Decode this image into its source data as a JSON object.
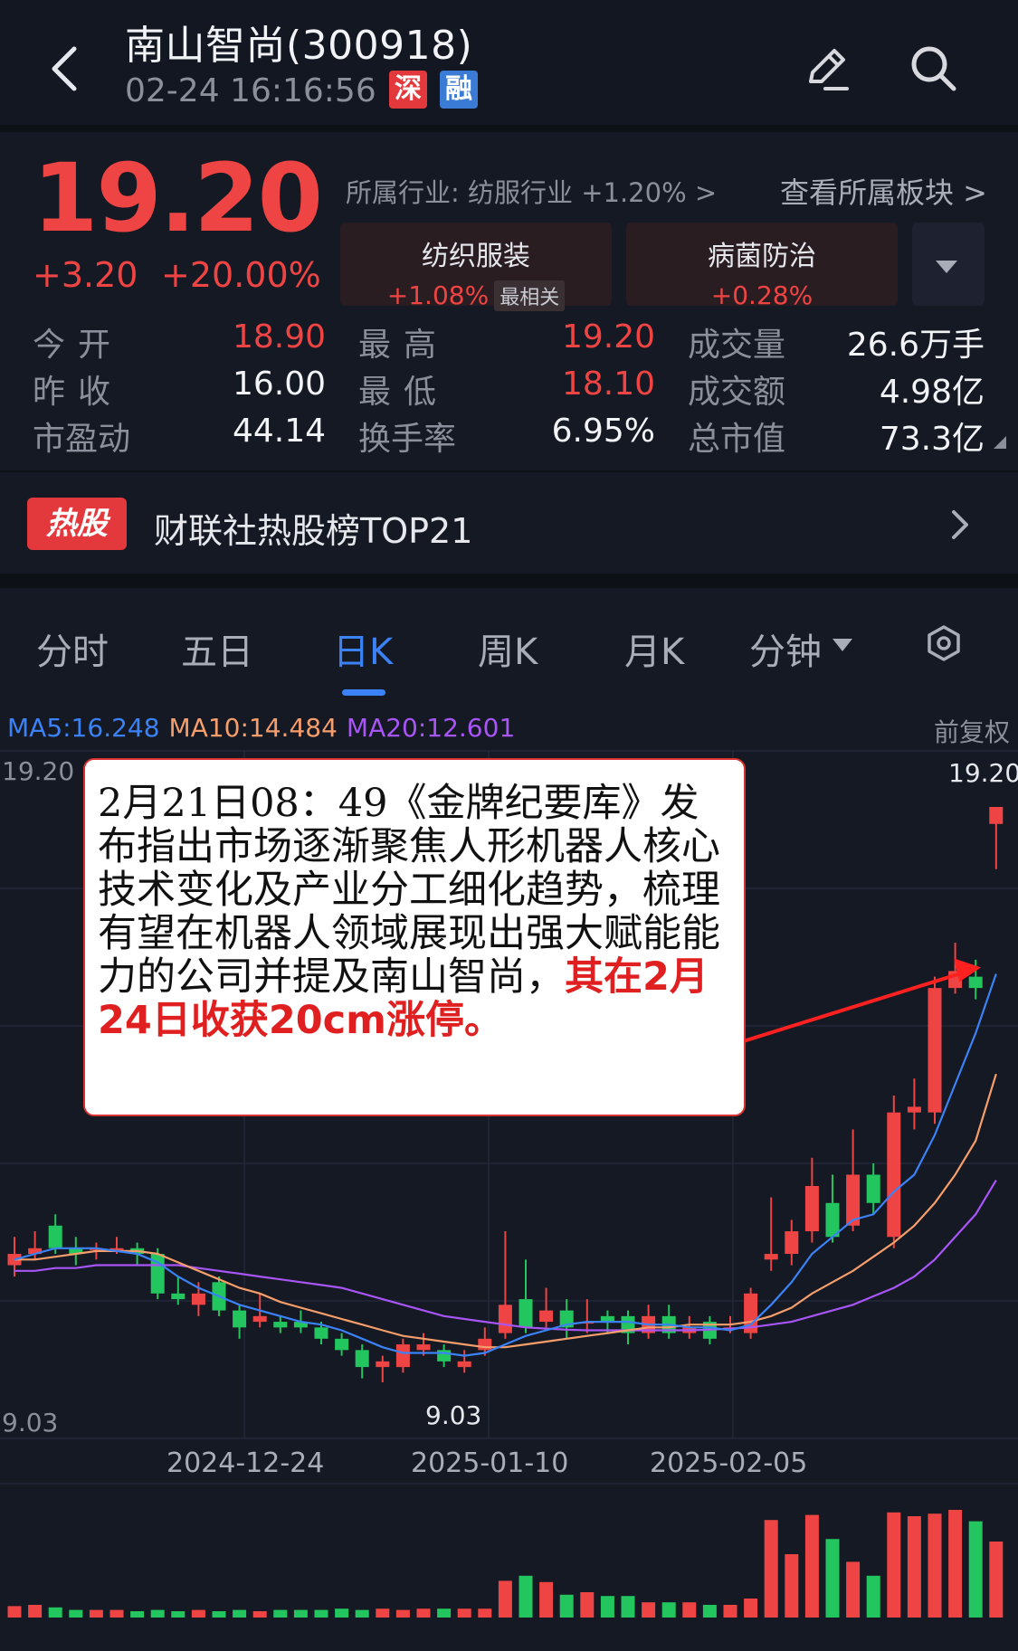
{
  "header": {
    "title": "南山智尚(300918)",
    "timestamp": "02-24 16:16:56",
    "tag_sz": "深",
    "tag_rong": "融",
    "icons": [
      "chevron-left-icon",
      "edit-icon",
      "search-icon"
    ]
  },
  "quote": {
    "price": "19.20",
    "change": "+3.20",
    "change_pct": "+20.00%",
    "industry": "所属行业: 纺服行业 +1.20% >",
    "view_sector": "查看所属板块 >",
    "sectors": [
      {
        "name": "纺织服装",
        "pct": "+1.08%",
        "badge": "最相关"
      },
      {
        "name": "病菌防治",
        "pct": "+0.28%"
      }
    ],
    "colors": {
      "up": "#ef4444",
      "down": "#22c55e",
      "accent": "#3b82f6"
    }
  },
  "stats": {
    "rows": [
      [
        {
          "label": "今开",
          "value": "18.90"
        },
        {
          "label": "最高",
          "value": "19.20"
        },
        {
          "label": "成交量",
          "value": "26.6万手"
        }
      ],
      [
        {
          "label": "昨收",
          "value": "16.00"
        },
        {
          "label": "最低",
          "value": "18.10"
        },
        {
          "label": "成交额",
          "value": "4.98亿"
        }
      ],
      [
        {
          "label": "市盈动",
          "value": "44.14"
        },
        {
          "label": "换手率",
          "value": "6.95%"
        },
        {
          "label": "总市值",
          "value": "73.3亿"
        }
      ]
    ]
  },
  "hot": {
    "badge": "热股",
    "text": "财联社热股榜TOP21"
  },
  "tabs": [
    "分时",
    "五日",
    "日K",
    "周K",
    "月K",
    "分钟"
  ],
  "active_tab": "日K",
  "ma": {
    "ma5": "MA5:16.248",
    "ma10": "MA10:14.484",
    "ma20": "MA20:12.601"
  },
  "adjust_label": "前复权",
  "y_labels": {
    "top_left": "19.20",
    "top_right": "19.20",
    "bottom_left": "9.03",
    "low": "9.03"
  },
  "x_labels": [
    "2024-12-24",
    "2025-01-10",
    "2025-02-05"
  ],
  "annotation": {
    "text": "2月21日08：49《金牌纪要库》发布指出市场逐渐聚焦人形机器人核心技术变化及产业分工细化趋势，梳理有望在机器人领域展现出强大赋能能力的公司并提及南山智尚，",
    "highlight": "其在2月24日收获20cm涨停。"
  },
  "chart_data": {
    "type": "candlestick",
    "ylim": [
      9.03,
      19.2
    ],
    "candles": [
      {
        "o": 11.1,
        "c": 11.3,
        "h": 11.6,
        "l": 10.9
      },
      {
        "o": 11.3,
        "c": 11.4,
        "h": 11.7,
        "l": 11.2
      },
      {
        "o": 11.8,
        "c": 11.4,
        "h": 12.0,
        "l": 11.3
      },
      {
        "o": 11.4,
        "c": 11.3,
        "h": 11.6,
        "l": 11.1
      },
      {
        "o": 11.4,
        "c": 11.4,
        "h": 11.5,
        "l": 11.2
      },
      {
        "o": 11.4,
        "c": 11.4,
        "h": 11.6,
        "l": 11.3
      },
      {
        "o": 11.4,
        "c": 11.3,
        "h": 11.5,
        "l": 11.1
      },
      {
        "o": 11.3,
        "c": 10.6,
        "h": 11.4,
        "l": 10.5
      },
      {
        "o": 10.6,
        "c": 10.5,
        "h": 10.9,
        "l": 10.4
      },
      {
        "o": 10.4,
        "c": 10.6,
        "h": 10.8,
        "l": 10.2
      },
      {
        "o": 10.8,
        "c": 10.3,
        "h": 10.9,
        "l": 10.2
      },
      {
        "o": 10.3,
        "c": 10.0,
        "h": 10.4,
        "l": 9.8
      },
      {
        "o": 10.1,
        "c": 10.2,
        "h": 10.6,
        "l": 10.0
      },
      {
        "o": 10.1,
        "c": 10.0,
        "h": 10.2,
        "l": 9.9
      },
      {
        "o": 10.1,
        "c": 10.0,
        "h": 10.3,
        "l": 9.9
      },
      {
        "o": 10.0,
        "c": 9.8,
        "h": 10.1,
        "l": 9.7
      },
      {
        "o": 9.8,
        "c": 9.6,
        "h": 9.9,
        "l": 9.5
      },
      {
        "o": 9.6,
        "c": 9.3,
        "h": 9.7,
        "l": 9.1
      },
      {
        "o": 9.3,
        "c": 9.4,
        "h": 9.5,
        "l": 9.03
      },
      {
        "o": 9.3,
        "c": 9.7,
        "h": 9.8,
        "l": 9.2
      },
      {
        "o": 9.6,
        "c": 9.7,
        "h": 9.9,
        "l": 9.5
      },
      {
        "o": 9.6,
        "c": 9.4,
        "h": 9.7,
        "l": 9.3
      },
      {
        "o": 9.3,
        "c": 9.4,
        "h": 9.6,
        "l": 9.2
      },
      {
        "o": 9.6,
        "c": 9.8,
        "h": 10.0,
        "l": 9.5
      },
      {
        "o": 9.9,
        "c": 10.4,
        "h": 11.7,
        "l": 9.8
      },
      {
        "o": 10.5,
        "c": 10.0,
        "h": 11.2,
        "l": 9.9
      },
      {
        "o": 10.1,
        "c": 10.3,
        "h": 10.7,
        "l": 10.0
      },
      {
        "o": 10.3,
        "c": 10.0,
        "h": 10.5,
        "l": 9.8
      },
      {
        "o": 10.1,
        "c": 10.1,
        "h": 10.5,
        "l": 9.9
      },
      {
        "o": 10.2,
        "c": 10.1,
        "h": 10.3,
        "l": 9.9
      },
      {
        "o": 10.2,
        "c": 9.9,
        "h": 10.3,
        "l": 9.7
      },
      {
        "o": 9.9,
        "c": 10.2,
        "h": 10.4,
        "l": 9.8
      },
      {
        "o": 10.2,
        "c": 9.9,
        "h": 10.4,
        "l": 9.8
      },
      {
        "o": 9.9,
        "c": 10.0,
        "h": 10.2,
        "l": 9.8
      },
      {
        "o": 10.1,
        "c": 9.8,
        "h": 10.2,
        "l": 9.7
      },
      {
        "o": 10.0,
        "c": 10.0,
        "h": 10.2,
        "l": 9.9
      },
      {
        "o": 9.9,
        "c": 10.6,
        "h": 10.7,
        "l": 9.8
      },
      {
        "o": 11.2,
        "c": 11.3,
        "h": 12.3,
        "l": 11.0
      },
      {
        "o": 11.3,
        "c": 11.7,
        "h": 11.9,
        "l": 11.1
      },
      {
        "o": 11.7,
        "c": 12.5,
        "h": 13.0,
        "l": 11.5
      },
      {
        "o": 12.2,
        "c": 11.6,
        "h": 12.7,
        "l": 11.5
      },
      {
        "o": 11.8,
        "c": 12.7,
        "h": 13.5,
        "l": 11.7
      },
      {
        "o": 12.7,
        "c": 12.2,
        "h": 12.9,
        "l": 12.0
      },
      {
        "o": 11.6,
        "c": 13.8,
        "h": 14.1,
        "l": 11.4
      },
      {
        "o": 13.8,
        "c": 13.9,
        "h": 14.4,
        "l": 13.5
      },
      {
        "o": 13.8,
        "c": 16.0,
        "h": 16.2,
        "l": 13.6
      },
      {
        "o": 16.0,
        "c": 16.3,
        "h": 16.8,
        "l": 15.9
      },
      {
        "o": 16.2,
        "c": 16.0,
        "h": 16.5,
        "l": 15.8
      },
      {
        "o": 18.9,
        "c": 19.2,
        "h": 19.2,
        "l": 18.1
      }
    ],
    "volumes": [
      0.09,
      0.1,
      0.08,
      0.06,
      0.06,
      0.06,
      0.05,
      0.06,
      0.05,
      0.06,
      0.05,
      0.06,
      0.05,
      0.06,
      0.06,
      0.06,
      0.07,
      0.06,
      0.07,
      0.06,
      0.07,
      0.07,
      0.07,
      0.07,
      0.29,
      0.33,
      0.28,
      0.18,
      0.2,
      0.17,
      0.17,
      0.12,
      0.12,
      0.12,
      0.1,
      0.1,
      0.15,
      0.77,
      0.5,
      0.81,
      0.62,
      0.44,
      0.33,
      0.83,
      0.8,
      0.82,
      0.85,
      0.76,
      0.6
    ],
    "ma5": [
      11.2,
      11.3,
      11.4,
      11.4,
      11.4,
      11.35,
      11.3,
      11.15,
      10.9,
      10.7,
      10.55,
      10.4,
      10.3,
      10.2,
      10.1,
      10.05,
      9.95,
      9.8,
      9.65,
      9.55,
      9.55,
      9.55,
      9.5,
      9.55,
      9.7,
      9.85,
      9.95,
      10.05,
      10.1,
      10.1,
      10.1,
      10.05,
      10.05,
      10.0,
      10.0,
      9.95,
      10.05,
      10.4,
      10.8,
      11.3,
      11.6,
      11.9,
      12.0,
      12.4,
      12.7,
      13.4,
      14.3,
      15.2,
      16.25
    ],
    "ma10": [
      11.2,
      11.2,
      11.25,
      11.3,
      11.35,
      11.35,
      11.35,
      11.3,
      11.15,
      11.0,
      10.85,
      10.7,
      10.6,
      10.45,
      10.35,
      10.25,
      10.15,
      10.05,
      9.95,
      9.85,
      9.8,
      9.75,
      9.7,
      9.65,
      9.65,
      9.7,
      9.75,
      9.8,
      9.85,
      9.9,
      9.95,
      10.0,
      10.0,
      10.05,
      10.05,
      10.05,
      10.1,
      10.2,
      10.35,
      10.6,
      10.8,
      11.0,
      11.25,
      11.5,
      11.8,
      12.2,
      12.7,
      13.3,
      14.48
    ],
    "ma20": [
      11.0,
      11.0,
      11.05,
      11.05,
      11.1,
      11.1,
      11.1,
      11.1,
      11.1,
      11.05,
      11.0,
      10.95,
      10.9,
      10.85,
      10.8,
      10.75,
      10.7,
      10.6,
      10.5,
      10.4,
      10.3,
      10.2,
      10.15,
      10.1,
      10.05,
      10.0,
      9.98,
      9.96,
      9.95,
      9.95,
      9.95,
      9.95,
      9.95,
      9.95,
      9.96,
      9.98,
      10.0,
      10.05,
      10.1,
      10.2,
      10.3,
      10.4,
      10.55,
      10.7,
      10.9,
      11.2,
      11.6,
      12.0,
      12.6
    ]
  }
}
